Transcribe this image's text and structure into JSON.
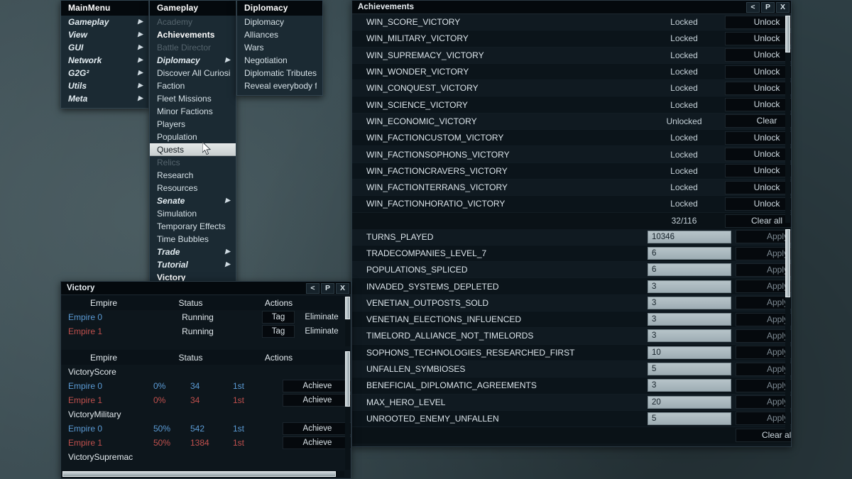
{
  "main_menu": {
    "title": "MainMenu",
    "items": [
      {
        "label": "Gameplay",
        "style": "italic-bold",
        "arrow": true,
        "dim": false
      },
      {
        "label": "View",
        "style": "italic",
        "arrow": true,
        "dim": false
      },
      {
        "label": "GUI",
        "style": "italic",
        "arrow": true,
        "dim": false
      },
      {
        "label": "Network",
        "style": "italic",
        "arrow": true,
        "dim": false
      },
      {
        "label": "G2G²",
        "style": "italic",
        "arrow": true,
        "dim": false
      },
      {
        "label": "Utils",
        "style": "italic",
        "arrow": true,
        "dim": false
      },
      {
        "label": "Meta",
        "style": "italic",
        "arrow": true,
        "dim": false
      }
    ]
  },
  "gameplay_menu": {
    "title": "Gameplay",
    "items": [
      {
        "label": "Academy",
        "style": "dim",
        "arrow": false
      },
      {
        "label": "Achievements",
        "style": "bold",
        "arrow": false
      },
      {
        "label": "Battle Director",
        "style": "dim",
        "arrow": false
      },
      {
        "label": "Diplomacy",
        "style": "italic-bold",
        "arrow": true
      },
      {
        "label": "Discover All Curiosit",
        "style": "normal",
        "arrow": false
      },
      {
        "label": "Faction",
        "style": "normal",
        "arrow": false
      },
      {
        "label": "Fleet Missions",
        "style": "normal",
        "arrow": false
      },
      {
        "label": "Minor Factions",
        "style": "normal",
        "arrow": false
      },
      {
        "label": "Players",
        "style": "normal",
        "arrow": false
      },
      {
        "label": "Population",
        "style": "normal",
        "arrow": false
      },
      {
        "label": "Quests",
        "style": "selected",
        "arrow": false
      },
      {
        "label": "Relics",
        "style": "dim",
        "arrow": false
      },
      {
        "label": "Research",
        "style": "normal",
        "arrow": false
      },
      {
        "label": "Resources",
        "style": "normal",
        "arrow": false
      },
      {
        "label": "Senate",
        "style": "italic",
        "arrow": true
      },
      {
        "label": "Simulation",
        "style": "normal",
        "arrow": false
      },
      {
        "label": "Temporary Effects",
        "style": "normal",
        "arrow": false
      },
      {
        "label": "Time Bubbles",
        "style": "normal",
        "arrow": false
      },
      {
        "label": "Trade",
        "style": "italic",
        "arrow": true
      },
      {
        "label": "Tutorial",
        "style": "italic",
        "arrow": true
      },
      {
        "label": "Victory",
        "style": "bold",
        "arrow": false
      }
    ]
  },
  "diplomacy_menu": {
    "title": "Diplomacy",
    "items": [
      {
        "label": "Diplomacy",
        "style": "normal",
        "arrow": false
      },
      {
        "label": "Alliances",
        "style": "normal",
        "arrow": false
      },
      {
        "label": "Wars",
        "style": "normal",
        "arrow": false
      },
      {
        "label": "Negotiation",
        "style": "normal",
        "arrow": false
      },
      {
        "label": "Diplomatic Tributes",
        "style": "normal",
        "arrow": false
      },
      {
        "label": "Reveal everybody fo",
        "style": "normal",
        "arrow": false
      }
    ]
  },
  "achievements_window": {
    "title": "Achievements",
    "window_buttons": [
      "<",
      "P",
      "X"
    ],
    "rows": [
      {
        "name": "WIN_SCORE_VICTORY",
        "state": "Locked",
        "action": "Unlock"
      },
      {
        "name": "WIN_MILITARY_VICTORY",
        "state": "Locked",
        "action": "Unlock"
      },
      {
        "name": "WIN_SUPREMACY_VICTORY",
        "state": "Locked",
        "action": "Unlock"
      },
      {
        "name": "WIN_WONDER_VICTORY",
        "state": "Locked",
        "action": "Unlock"
      },
      {
        "name": "WIN_CONQUEST_VICTORY",
        "state": "Locked",
        "action": "Unlock"
      },
      {
        "name": "WIN_SCIENCE_VICTORY",
        "state": "Locked",
        "action": "Unlock"
      },
      {
        "name": "WIN_ECONOMIC_VICTORY",
        "state": "Unlocked",
        "action": "Clear"
      },
      {
        "name": "WIN_FACTIONCUSTOM_VICTORY",
        "state": "Locked",
        "action": "Unlock"
      },
      {
        "name": "WIN_FACTIONSOPHONS_VICTORY",
        "state": "Locked",
        "action": "Unlock"
      },
      {
        "name": "WIN_FACTIONCRAVERS_VICTORY",
        "state": "Locked",
        "action": "Unlock"
      },
      {
        "name": "WIN_FACTIONTERRANS_VICTORY",
        "state": "Locked",
        "action": "Unlock"
      },
      {
        "name": "WIN_FACTIONHORATIO_VICTORY",
        "state": "Locked",
        "action": "Unlock"
      }
    ],
    "summary": {
      "count": "32/116",
      "clear_all_label": "Clear all"
    },
    "stats": [
      {
        "name": "TURNS_PLAYED",
        "value": "10346",
        "action": "Apply"
      },
      {
        "name": "TRADECOMPANIES_LEVEL_7",
        "value": "6",
        "action": "Apply"
      },
      {
        "name": "POPULATIONS_SPLICED",
        "value": "6",
        "action": "Apply"
      },
      {
        "name": "INVADED_SYSTEMS_DEPLETED",
        "value": "3",
        "action": "Apply"
      },
      {
        "name": "VENETIAN_OUTPOSTS_SOLD",
        "value": "3",
        "action": "Apply"
      },
      {
        "name": "VENETIAN_ELECTIONS_INFLUENCED",
        "value": "3",
        "action": "Apply"
      },
      {
        "name": "TIMELORD_ALLIANCE_NOT_TIMELORDS",
        "value": "3",
        "action": "Apply"
      },
      {
        "name": "SOPHONS_TECHNOLOGIES_RESEARCHED_FIRST",
        "value": "10",
        "action": "Apply"
      },
      {
        "name": "UNFALLEN_SYMBIOSES",
        "value": "5",
        "action": "Apply"
      },
      {
        "name": "BENEFICIAL_DIPLOMATIC_AGREEMENTS",
        "value": "3",
        "action": "Apply"
      },
      {
        "name": "MAX_HERO_LEVEL",
        "value": "20",
        "action": "Apply"
      },
      {
        "name": "UNROOTED_ENEMY_UNFALLEN",
        "value": "5",
        "action": "Apply"
      }
    ],
    "stats_footer": {
      "clear_all_label": "Clear all"
    }
  },
  "victory_window": {
    "title": "Victory",
    "window_buttons": [
      "<",
      "P",
      "X"
    ],
    "top_headers": {
      "empire": "Empire",
      "status": "Status",
      "actions": "Actions"
    },
    "empires": [
      {
        "name": "Empire 0",
        "status": "Running",
        "tag": "Tag",
        "eliminate": "Eliminate",
        "color": "#5b9bd5"
      },
      {
        "name": "Empire 1",
        "status": "Running",
        "tag": "Tag",
        "eliminate": "Eliminate",
        "color": "#c0504d"
      }
    ],
    "bottom_headers": {
      "empire": "Empire",
      "status": "Status",
      "actions": "Actions"
    },
    "conditions": [
      {
        "title": "VictoryScore",
        "rows": [
          {
            "name": "Empire 0",
            "pct": "0%",
            "value": "34",
            "rank": "1st",
            "action": "Achieve",
            "color": "#5b9bd5"
          },
          {
            "name": "Empire 1",
            "pct": "0%",
            "value": "34",
            "rank": "1st",
            "action": "Achieve",
            "color": "#c0504d"
          }
        ]
      },
      {
        "title": "VictoryMilitary",
        "rows": [
          {
            "name": "Empire 0",
            "pct": "50%",
            "value": "542",
            "rank": "1st",
            "action": "Achieve",
            "color": "#5b9bd5"
          },
          {
            "name": "Empire 1",
            "pct": "50%",
            "value": "1384",
            "rank": "1st",
            "action": "Achieve",
            "color": "#c0504d"
          }
        ]
      },
      {
        "title": "VictorySupremac",
        "rows": []
      }
    ]
  }
}
